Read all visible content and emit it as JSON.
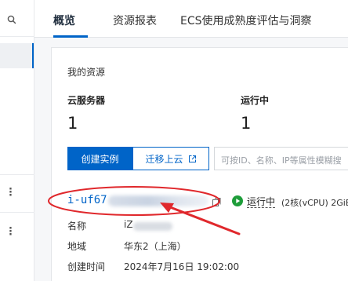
{
  "tabs": [
    {
      "label": "概览",
      "active": true
    },
    {
      "label": "资源报表",
      "active": false
    },
    {
      "label": "ECS使用成熟度评估与洞察",
      "active": false
    }
  ],
  "resources": {
    "title": "我的资源",
    "stats": [
      {
        "label": "云服务器",
        "value": "1"
      },
      {
        "label": "运行中",
        "value": "1"
      }
    ],
    "create_button": "创建实例",
    "migrate_button": "迁移上云",
    "search_placeholder": "可按ID、名称、IP等属性模糊搜"
  },
  "instance": {
    "id_prefix": "i-uf67",
    "status": "运行中",
    "spec": "(2核(vCPU) 2GiB",
    "details": [
      {
        "label": "名称",
        "value": "iZ"
      },
      {
        "label": "地域",
        "value": "华东2（上海）"
      },
      {
        "label": "创建时间",
        "value": "2024年7月16日 19:02:00"
      }
    ]
  },
  "colors": {
    "accent": "#0064c8",
    "status_running": "#1e9d3a",
    "annotation": "#e0282c"
  },
  "icons": {
    "rail_search": "search-icon",
    "migrate": "external-link-icon",
    "copy": "copy-icon",
    "status": "play-circle-icon"
  }
}
